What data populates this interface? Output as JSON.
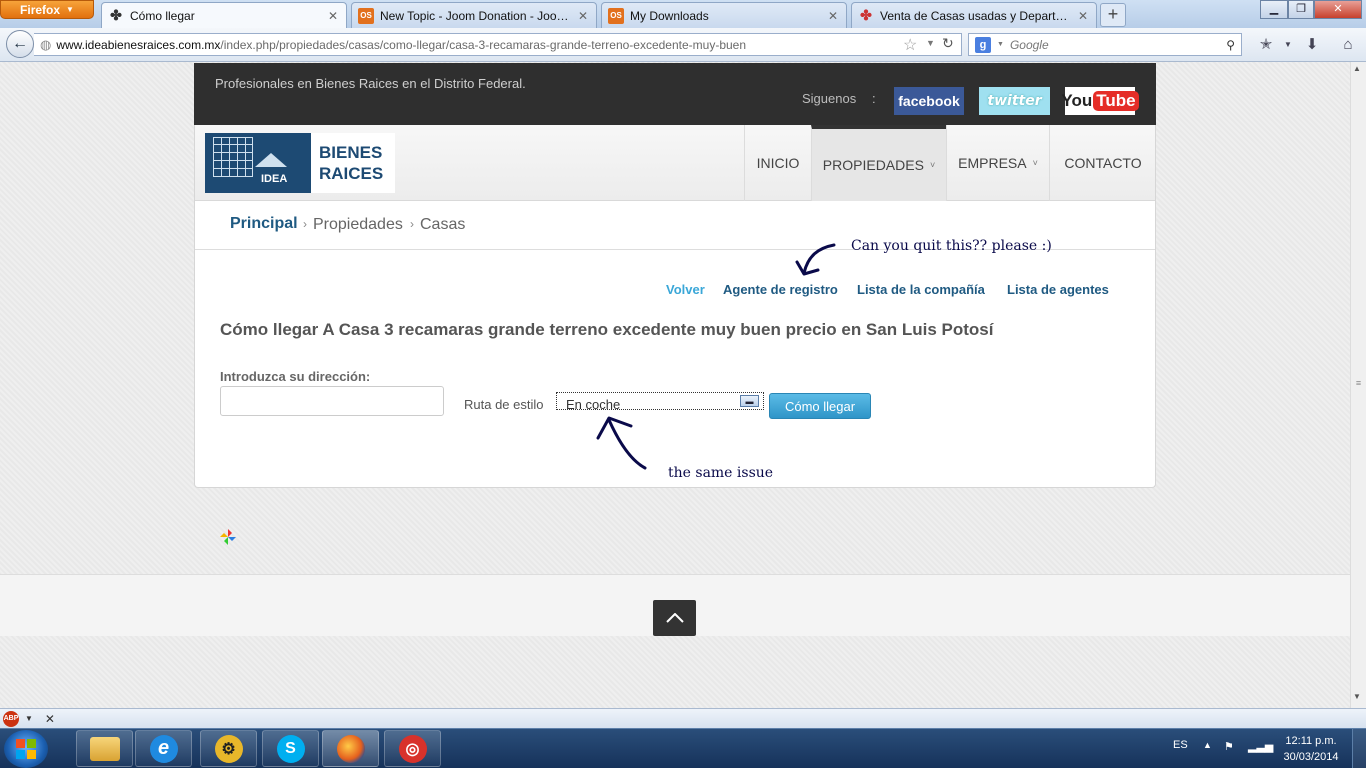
{
  "browser": {
    "app_button": "Firefox",
    "tabs": [
      {
        "title": "Cómo llegar",
        "icon": "joomla-icon",
        "active": true
      },
      {
        "title": "New Topic - Joom Donation - Joomla...",
        "icon": "os-favicon-icon",
        "active": false
      },
      {
        "title": "My Downloads",
        "icon": "os-favicon-icon",
        "active": false
      },
      {
        "title": "Venta de Casas usadas y Departamen...",
        "icon": "joomla-icon",
        "active": false
      }
    ],
    "url_host": "www.ideabienesraices.com.mx",
    "url_path": "/index.php/propiedades/casas/como-llegar/casa-3-recamaras-grande-terreno-excedente-muy-buen",
    "search_engine": "Google",
    "search_placeholder": "Google"
  },
  "site": {
    "tagline": "Profesionales en Bienes Raices en el Distrito Federal.",
    "follow_label": "Siguenos",
    "follow_colon": ":",
    "social": {
      "facebook": "facebook",
      "twitter": "twitter",
      "youtube_you": "You",
      "youtube_tube": "Tube"
    },
    "logo": {
      "word1": "BIENES",
      "word2": "RAICES",
      "mark": "IDEA"
    },
    "menu": [
      {
        "label": "INICIO",
        "has_caret": false
      },
      {
        "label": "PROPIEDADES",
        "has_caret": true,
        "active": true
      },
      {
        "label": "EMPRESA",
        "has_caret": true
      },
      {
        "label": "CONTACTO",
        "has_caret": false
      }
    ],
    "breadcrumb": {
      "home": "Principal",
      "sep": "›",
      "level1": "Propiedades",
      "level2": "Casas"
    },
    "toolbar_links": {
      "back": "Volver",
      "agent": "Agente de registro",
      "company_list": "Lista de la compañía",
      "agents_list": "Lista de agentes"
    },
    "page_title": "Cómo llegar A Casa 3 recamaras grande terreno excedente muy buen precio en San Luis Potosí",
    "form": {
      "address_label": "Introduzca su dirección:",
      "address_value": "",
      "route_label": "Ruta de estilo",
      "route_selected": "En coche",
      "submit": "Cómo llegar"
    }
  },
  "annotations": {
    "note_top": "Can you quit this?? please :)",
    "note_bottom": "the same issue"
  },
  "addon_bar": {
    "abp_label": "ABP"
  },
  "taskbar": {
    "apps": [
      "explorer-icon",
      "internet-explorer-icon",
      "tweaker-icon",
      "skype-icon",
      "firefox-icon",
      "photo-app-icon"
    ],
    "language": "ES",
    "time": "12:11 p.m.",
    "date": "30/03/2014"
  },
  "colors": {
    "accent_link": "#1f5a82",
    "button_blue": "#3aa7d8",
    "dark_header": "#2f2f2f",
    "facebook": "#3b5998",
    "youtube_red": "#e52d27",
    "annotation_ink": "#0a0a4a"
  }
}
